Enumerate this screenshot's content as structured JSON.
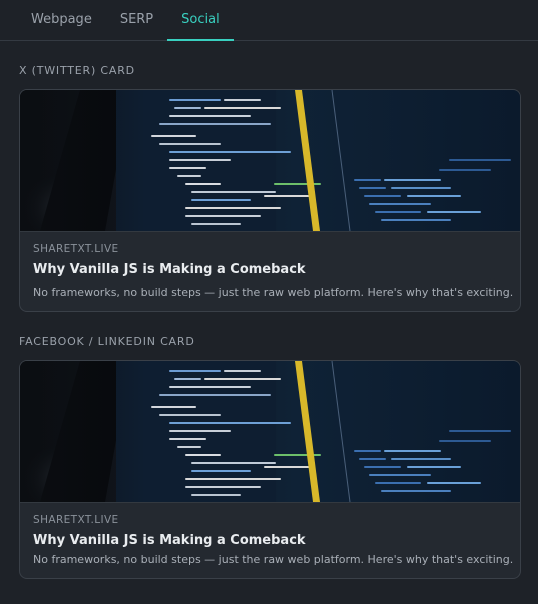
{
  "tabs": [
    {
      "label": "Webpage",
      "active": false
    },
    {
      "label": "SERP",
      "active": false
    },
    {
      "label": "Social",
      "active": true
    }
  ],
  "twitter": {
    "section_label": "X (TWITTER) CARD",
    "domain": "SHARETXT.LIVE",
    "title": "Why Vanilla JS is Making a Comeback",
    "description": "No frameworks, no build steps — just the raw web platform. Here's why that's exciting."
  },
  "facebook": {
    "section_label": "FACEBOOK / LINKEDIN CARD",
    "domain": "SHARETXT.LIVE",
    "title": "Why Vanilla JS is Making a Comeback",
    "description": "No frameworks, no build steps — just the raw web platform. Here's why that's exciting."
  },
  "colors": {
    "accent": "#39d0c0",
    "background": "#1e2228",
    "card": "#242930"
  }
}
